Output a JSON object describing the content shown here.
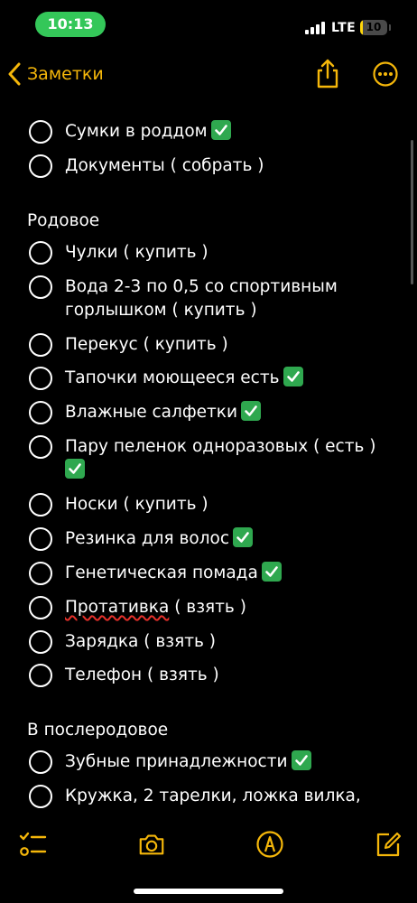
{
  "status_bar": {
    "time": "10:13",
    "network": "LTE",
    "battery_level": "10",
    "battery_fraction": 0.1
  },
  "nav": {
    "back_label": "Заметки"
  },
  "note": {
    "top_items": [
      {
        "text": "Сумки в роддом",
        "done_emoji": true
      },
      {
        "text": "Документы  ( собрать )",
        "done_emoji": false
      }
    ],
    "section_1": {
      "title": "Родовое",
      "items": [
        {
          "text": "Чулки ( купить )",
          "done_emoji": false
        },
        {
          "text": "Вода 2-3 по 0,5 со спортивным горлышком ( купить )",
          "done_emoji": false
        },
        {
          "text": "Перекус ( купить )",
          "done_emoji": false
        },
        {
          "text": "Тапочки моющееся есть",
          "done_emoji": true
        },
        {
          "text": "Влажные салфетки",
          "done_emoji": true
        },
        {
          "text": "Пару пеленок одноразовых ( есть )",
          "done_emoji": true
        },
        {
          "text": "Носки ( купить )",
          "done_emoji": false
        },
        {
          "text": "Резинка для волос",
          "done_emoji": true
        },
        {
          "text": "Генетическая помада",
          "done_emoji": true
        },
        {
          "text_misspelled": "Протативка",
          "text_rest": " ( взять )",
          "done_emoji": false
        },
        {
          "text": "Зарядка ( взять )",
          "done_emoji": false
        },
        {
          "text": "Телефон ( взять )",
          "done_emoji": false
        }
      ]
    },
    "section_2": {
      "title": "В послеродовое",
      "items": [
        {
          "text": "Зубные принадлежности",
          "done_emoji": true
        },
        {
          "text": "Кружка, 2 тарелки, ложка вилка,",
          "done_emoji": false
        }
      ]
    }
  },
  "icons": {
    "accent_color": "#f5b70a",
    "checkmark_color": "#2fa84f",
    "time_pill_color": "#34c759"
  }
}
